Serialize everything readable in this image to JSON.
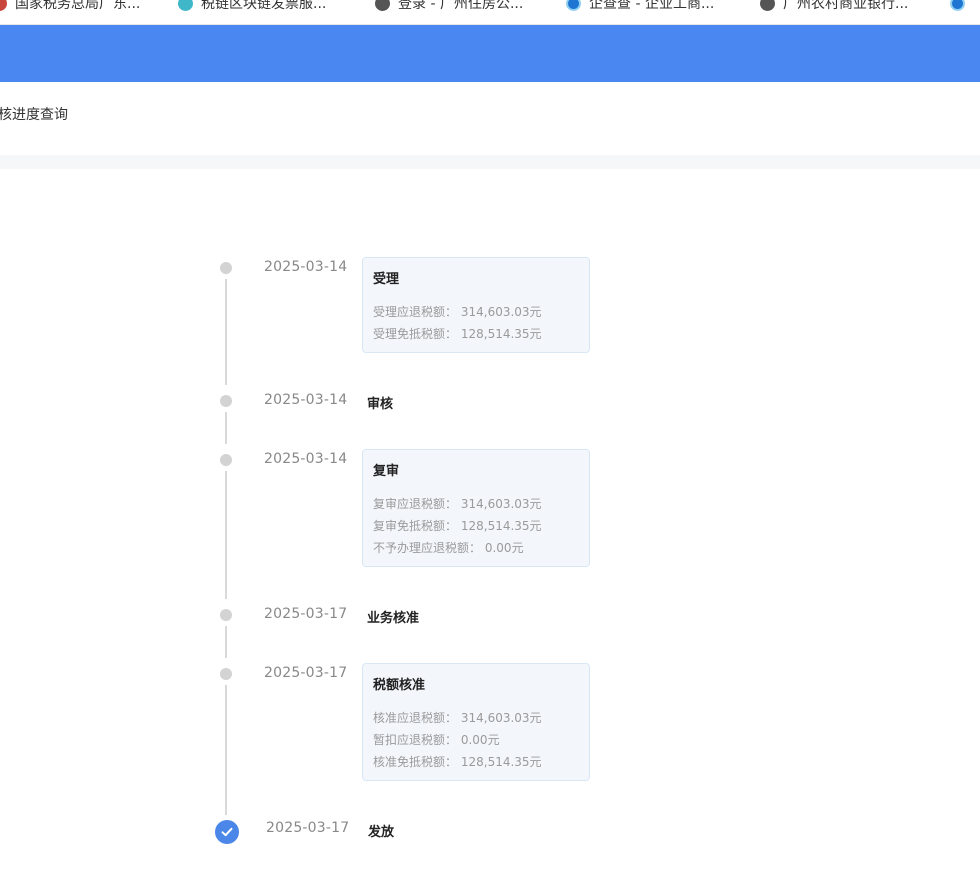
{
  "bookmarks": [
    {
      "label": "国家税务总局广东...",
      "icon": "tax-emblem-icon"
    },
    {
      "label": "税链区块链发票服...",
      "icon": "blockchain-icon"
    },
    {
      "label": "登录 - 广州住房公...",
      "icon": "globe-icon"
    },
    {
      "label": "企查查 - 企业工商...",
      "icon": "qichacha-icon"
    },
    {
      "label": "广州农村商业银行...",
      "icon": "globe-icon"
    }
  ],
  "header": {
    "color": "#4a87f0"
  },
  "page": {
    "title": "审核进度查询",
    "title_visible": "核进度查询"
  },
  "timeline": [
    {
      "date": "2025-03-14",
      "title": "受理",
      "lines": [
        {
          "label": "受理应退税额：",
          "value": "314,603.03元"
        },
        {
          "label": "受理免抵税额：",
          "value": "128,514.35元"
        }
      ]
    },
    {
      "date": "2025-03-14",
      "title": "审核",
      "lines": []
    },
    {
      "date": "2025-03-14",
      "title": "复审",
      "lines": [
        {
          "label": "复审应退税额：",
          "value": "314,603.03元"
        },
        {
          "label": "复审免抵税额：",
          "value": "128,514.35元"
        },
        {
          "label": "不予办理应退税额：",
          "value": "0.00元"
        }
      ]
    },
    {
      "date": "2025-03-17",
      "title": "业务核准",
      "lines": []
    },
    {
      "date": "2025-03-17",
      "title": "税额核准",
      "lines": [
        {
          "label": "核准应退税额：",
          "value": "314,603.03元"
        },
        {
          "label": "暂扣应退税额：",
          "value": "0.00元"
        },
        {
          "label": "核准免抵税额：",
          "value": "128,514.35元"
        }
      ]
    },
    {
      "date": "2025-03-17",
      "title": "发放",
      "status": "completed",
      "lines": []
    }
  ]
}
